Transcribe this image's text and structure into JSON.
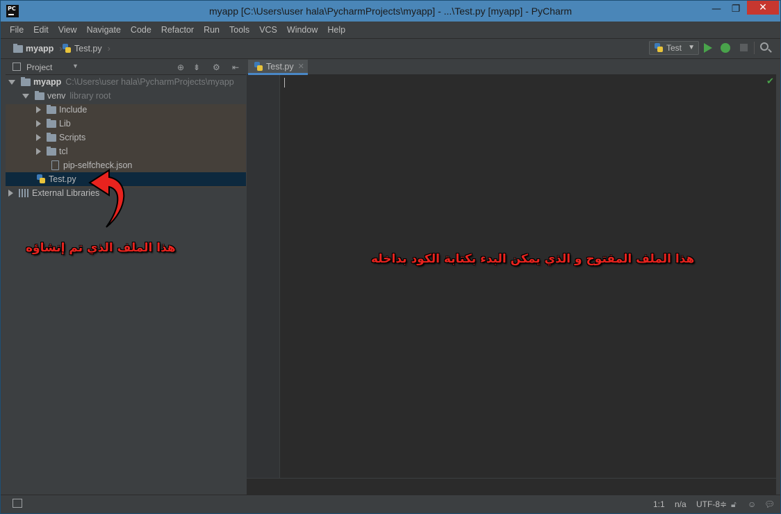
{
  "window": {
    "title": "myapp [C:\\Users\\user hala\\PycharmProjects\\myapp] - ...\\Test.py [myapp] - PyCharm",
    "logo": "PC",
    "controls": {
      "minimize": "—",
      "maximize": "❐",
      "close": "✕"
    }
  },
  "menu": [
    "File",
    "Edit",
    "View",
    "Navigate",
    "Code",
    "Refactor",
    "Run",
    "Tools",
    "VCS",
    "Window",
    "Help"
  ],
  "breadcrumb": {
    "project": "myapp",
    "file": "Test.py"
  },
  "toolbar": {
    "run_config": "Test"
  },
  "project_panel": {
    "title": "Project",
    "root": {
      "name": "myapp",
      "path": "C:\\Users\\user hala\\PycharmProjects\\myapp"
    },
    "venv": {
      "name": "venv",
      "tag": "library root"
    },
    "venv_children": [
      "Include",
      "Lib",
      "Scripts",
      "tcl"
    ],
    "venv_file": "pip-selfcheck.json",
    "selected_file": "Test.py",
    "external": "External Libraries"
  },
  "editor": {
    "tab_label": "Test.py",
    "content": ""
  },
  "status": {
    "position": "1:1",
    "na": "n/a",
    "encoding": "UTF-8≑"
  },
  "annotations": {
    "left": "هذا الملف الذي تم إنشاؤه",
    "right": "هذا الملف المفتوح و الذي يمكن البدء بكتابة الكود بداخله"
  },
  "colors": {
    "accent": "#4a88c7",
    "annotation": "#e8231e",
    "run": "#49a34b"
  }
}
